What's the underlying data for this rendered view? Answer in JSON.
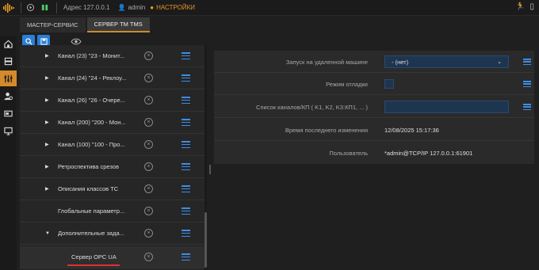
{
  "topbar": {
    "address": "Адрес 127.0.0.1",
    "user": "admin",
    "settings": "НАСТРОЙКИ"
  },
  "tabs": [
    {
      "label": "МАСТЕР-СЕРВИС",
      "active": false
    },
    {
      "label": "СЕРВЕР TM TMS",
      "active": true
    }
  ],
  "tree": {
    "items": [
      {
        "label": "Канал (23) \"23 - Монит...",
        "expand": "▶"
      },
      {
        "label": "Канал (24) \"24 - Реклоу...",
        "expand": "▶"
      },
      {
        "label": "Канал (26) \"26 - Очере...",
        "expand": "▶"
      },
      {
        "label": "Канал (200) \"200 - Мон...",
        "expand": "▶"
      },
      {
        "label": "Канал (100) \"100 - Про...",
        "expand": "▶"
      },
      {
        "label": "Ретроспектива срезов",
        "expand": "▶"
      },
      {
        "label": "Описания классов ТС",
        "expand": "▶"
      },
      {
        "label": "Глобальные параметр...",
        "expand": ""
      },
      {
        "label": "Дополнительные зада...",
        "expand": "▼"
      },
      {
        "label": "Сервер OPC UA",
        "expand": ""
      }
    ]
  },
  "properties": [
    {
      "label": "Запуск на удаленной машине",
      "value": "- (нет)"
    },
    {
      "label": "Режим отладки",
      "value": ""
    },
    {
      "label": "Список каналов/КП ( K1, K2, K3:КП1, ... )",
      "value": ""
    },
    {
      "label": "Время последнего изменения",
      "value": "12/08/2025 15:17:36"
    },
    {
      "label": "Пользователь",
      "value": "*admin@TCP/IP 127.0.0.1:61901"
    }
  ],
  "colors": {
    "accent": "#d48a2a",
    "menu_blue": "#3a8ee8",
    "selected_underline": "#e03030"
  }
}
